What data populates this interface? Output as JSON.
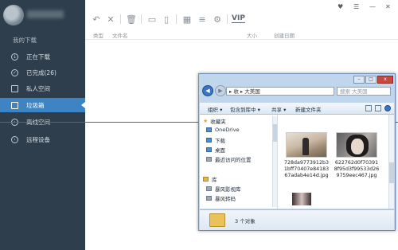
{
  "sidebar": {
    "section_title": "我的下载",
    "items": [
      {
        "label": "正在下载",
        "icon": "download-arrow-icon"
      },
      {
        "label": "已完成(26)",
        "icon": "check-circle-icon"
      },
      {
        "label": "私人空间",
        "icon": "lock-icon"
      },
      {
        "label": "垃圾箱",
        "icon": "trash-icon"
      },
      {
        "label": "离线空间",
        "icon": "cloud-icon"
      },
      {
        "label": "远程设备",
        "icon": "remote-device-icon"
      }
    ]
  },
  "toolbar": {
    "vip_label": "VIP",
    "window_controls": [
      "♥",
      "☰",
      "—",
      "✕"
    ]
  },
  "columns": {
    "type": "类型",
    "name": "文件名",
    "size": "大小",
    "date": "创建日期"
  },
  "explorer": {
    "address_parts": [
      "收",
      "大美国"
    ],
    "search_placeholder": "搜索 大美国",
    "command_bar": {
      "organize": "组织 ▾",
      "include": "包含到库中 ▾",
      "share": "共享 ▾",
      "new_folder": "新建文件夹"
    },
    "nav_items": [
      {
        "label": "收藏夹",
        "kind": "star"
      },
      {
        "label": "OneDrive",
        "kind": "cloud"
      },
      {
        "label": "下载",
        "kind": "folder"
      },
      {
        "label": "桌面",
        "kind": "folder"
      },
      {
        "label": "最近访问的位置",
        "kind": "folder"
      },
      {
        "label": "库",
        "kind": "library"
      },
      {
        "label": "暴风影视库",
        "kind": "library"
      },
      {
        "label": "暴风转码",
        "kind": "library"
      }
    ],
    "files": [
      {
        "name": "728da9773912b31bff70407e8418367adab4e14d.jpg"
      },
      {
        "name": "622762d0f703918f95d3f99533d269759eec467.jpg"
      }
    ],
    "status_text": "3 个对象"
  }
}
